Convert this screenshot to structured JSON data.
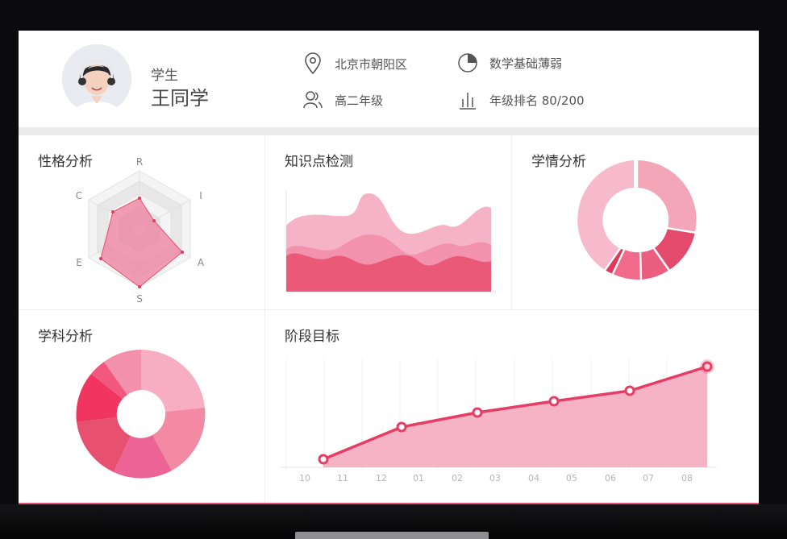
{
  "profile": {
    "role": "学生",
    "name": "王同学",
    "location": "北京市朝阳区",
    "grade": "高二年级",
    "weakness": "数学基础薄弱",
    "ranking": "年级排名 80/200"
  },
  "panels": {
    "personality": "性格分析",
    "knowledge": "知识点检测",
    "learning": "学情分析",
    "subjects": "学科分析",
    "goals": "阶段目标"
  },
  "radar": {
    "axes": [
      "R",
      "I",
      "A",
      "S",
      "E",
      "C"
    ]
  },
  "stage_chart": {
    "months": [
      "10",
      "11",
      "12",
      "01",
      "02",
      "03",
      "04",
      "05",
      "06",
      "07",
      "08"
    ]
  },
  "colors": {
    "accent": "#e94e77",
    "pink_light": "#f7b6c8",
    "pink_mid": "#ef8aa7",
    "pink_dark": "#e54b6e"
  }
}
